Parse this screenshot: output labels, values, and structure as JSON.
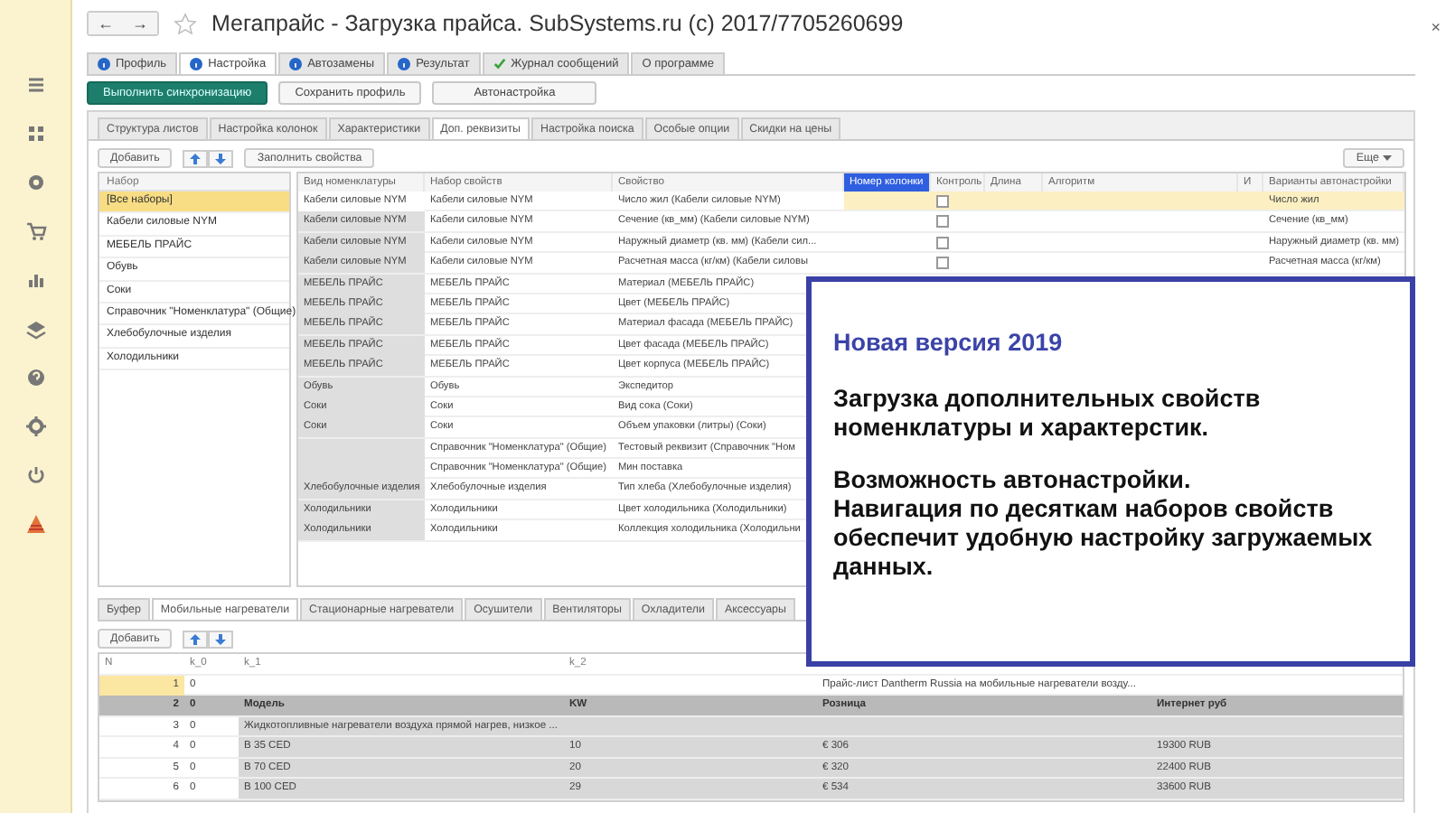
{
  "window": {
    "title": "Мегапрайс - Загрузка прайса. SubSystems.ru (c) 2017/7705260699",
    "back": "←",
    "forward": "→",
    "close": "×"
  },
  "tabs": [
    {
      "label": "Профиль",
      "kind": "info",
      "selected": false
    },
    {
      "label": "Настройка",
      "kind": "info",
      "selected": true
    },
    {
      "label": "Автозамены",
      "kind": "info",
      "selected": false
    },
    {
      "label": "Результат",
      "kind": "info",
      "selected": false
    },
    {
      "label": "Журнал сообщений",
      "kind": "check",
      "selected": false
    },
    {
      "label": "О программе",
      "kind": "plain",
      "selected": false
    }
  ],
  "actions": [
    {
      "label": "Выполнить синхронизацию",
      "kind": "primary"
    },
    {
      "label": "Сохранить профиль",
      "kind": "normal"
    },
    {
      "label": "Автонастройка",
      "kind": "wide"
    }
  ],
  "subtabs": [
    {
      "label": "Структура листов",
      "selected": false
    },
    {
      "label": "Настройка колонок",
      "selected": false
    },
    {
      "label": "Характеристики",
      "selected": false
    },
    {
      "label": "Доп. реквизиты",
      "selected": true
    },
    {
      "label": "Настройка поиска",
      "selected": false
    },
    {
      "label": "Особые опции",
      "selected": false
    },
    {
      "label": "Скидки на цены",
      "selected": false
    }
  ],
  "toolbar": {
    "add": "Добавить",
    "fill": "Заполнить свойства",
    "more": "Еще"
  },
  "sets": {
    "header": "Набор",
    "items": [
      {
        "label": "[Все наборы]",
        "selected": true
      },
      {
        "label": "Кабели силовые NYM",
        "selected": false
      },
      {
        "label": "МЕБЕЛЬ ПРАЙС",
        "selected": false
      },
      {
        "label": "Обувь",
        "selected": false
      },
      {
        "label": "Соки",
        "selected": false
      },
      {
        "label": "Справочник \"Номенклатура\" (Общие)",
        "selected": false
      },
      {
        "label": "Хлебобулочные изделия",
        "selected": false
      },
      {
        "label": "Холодильники",
        "selected": false
      }
    ]
  },
  "properties": {
    "columns": [
      {
        "label": "Вид номенклатуры",
        "selected": false
      },
      {
        "label": "Набор свойств",
        "selected": false
      },
      {
        "label": "Свойство",
        "selected": false
      },
      {
        "label": "Номер колонки",
        "selected": true
      },
      {
        "label": "Контроль",
        "selected": false
      },
      {
        "label": "Длина",
        "selected": false
      },
      {
        "label": "Алгоритм",
        "selected": false
      },
      {
        "label": "И",
        "selected": false
      },
      {
        "label": "Варианты автонастройки",
        "selected": false
      }
    ],
    "rows": [
      {
        "type": "Кабели силовые NYM",
        "set": "Кабели силовые NYM",
        "property": "Число жил (Кабели силовые NYM)",
        "checked": false,
        "variant": "Число жил",
        "selected": true
      },
      {
        "type": "Кабели силовые NYM",
        "set": "Кабели силовые NYM",
        "property": "Сечение (кв_мм) (Кабели силовые NYM)",
        "checked": false,
        "variant": "Сечение (кв_мм)",
        "selected": false
      },
      {
        "type": "Кабели силовые NYM",
        "set": "Кабели силовые NYM",
        "property": "Наружный диаметр (кв. мм) (Кабели сил...",
        "checked": false,
        "variant": "Наружный диаметр (кв. мм)",
        "selected": false
      },
      {
        "type": "Кабели силовые NYM",
        "set": "Кабели силовые NYM",
        "property": "Расчетная масса (кг/км) (Кабели силовы",
        "checked": false,
        "variant": "Расчетная масса (кг/км)",
        "selected": false
      },
      {
        "type": "МЕБЕЛЬ ПРАЙС",
        "set": "МЕБЕЛЬ ПРАЙС",
        "property": "Материал (МЕБЕЛЬ ПРАЙС)",
        "selected": false
      },
      {
        "type": "МЕБЕЛЬ ПРАЙС",
        "set": "МЕБЕЛЬ ПРАЙС",
        "property": "Цвет (МЕБЕЛЬ ПРАЙС)",
        "selected": false
      },
      {
        "type": "МЕБЕЛЬ ПРАЙС",
        "set": "МЕБЕЛЬ ПРАЙС",
        "property": "Материал фасада (МЕБЕЛЬ ПРАЙС)",
        "selected": false
      },
      {
        "type": "МЕБЕЛЬ ПРАЙС",
        "set": "МЕБЕЛЬ ПРАЙС",
        "property": "Цвет фасада (МЕБЕЛЬ ПРАЙС)",
        "selected": false
      },
      {
        "type": "МЕБЕЛЬ ПРАЙС",
        "set": "МЕБЕЛЬ ПРАЙС",
        "property": "Цвет корпуса (МЕБЕЛЬ ПРАЙС)",
        "selected": false
      },
      {
        "type": "Обувь",
        "set": "Обувь",
        "property": "Экспедитор",
        "selected": false
      },
      {
        "type": "Соки",
        "set": "Соки",
        "property": "Вид сока (Соки)",
        "selected": false
      },
      {
        "type": "Соки",
        "set": "Соки",
        "property": "Объем упаковки (литры) (Соки)",
        "selected": false
      },
      {
        "set": "Справочник \"Номенклатура\" (Общие)",
        "property": "Тестовый реквизит (Справочник \"Ном",
        "selected": false
      },
      {
        "set": "Справочник \"Номенклатура\" (Общие)",
        "property": "Мин поставка",
        "selected": false
      },
      {
        "type": "Хлебобулочные изделия",
        "set": "Хлебобулочные изделия",
        "property": "Тип хлеба (Хлебобулочные изделия)",
        "selected": false
      },
      {
        "type": "Холодильники",
        "set": "Холодильники",
        "property": "Цвет холодильника (Холодильники)",
        "selected": false
      },
      {
        "type": "Холодильники",
        "set": "Холодильники",
        "property": "Коллекция холодильника (Холодильни",
        "selected": false
      }
    ]
  },
  "lower_tabs": [
    {
      "label": "Буфер",
      "selected": false
    },
    {
      "label": "Мобильные нагреватели",
      "selected": true
    },
    {
      "label": "Стационарные нагреватели",
      "selected": false
    },
    {
      "label": "Осушители",
      "selected": false
    },
    {
      "label": "Вентиляторы",
      "selected": false
    },
    {
      "label": "Охладители",
      "selected": false
    },
    {
      "label": "Аксессуары",
      "selected": false
    }
  ],
  "lower_toolbar": {
    "add": "Добавить"
  },
  "sheet": {
    "columns": [
      "N",
      "k_0",
      "k_1",
      "k_2"
    ],
    "rows": [
      {
        "kind": "title",
        "selected": true,
        "n": "1",
        "k_0": "0",
        "k_3": "Прайс-лист Dantherm Russia на мобильные нагреватели возду..."
      },
      {
        "kind": "header",
        "selected": false,
        "n": "2",
        "k_0": "0",
        "k_1": "Модель",
        "k_2": "KW",
        "k_3": "Розница",
        "k_4": "Интернет руб"
      },
      {
        "kind": "item",
        "selected": false,
        "n": "3",
        "k_0": "0",
        "k_1": "Жидкотопливные нагреватели воздуха прямой нагрев, низкое ..."
      },
      {
        "kind": "item",
        "selected": false,
        "n": "4",
        "k_0": "0",
        "k_1": "B 35 CED",
        "k_2": "10",
        "k_3": "€ 306",
        "k_4": "19300 RUB"
      },
      {
        "kind": "item",
        "selected": false,
        "n": "5",
        "k_0": "0",
        "k_1": "B 70 CED",
        "k_2": "20",
        "k_3": "€ 320",
        "k_4": "22400 RUB"
      },
      {
        "kind": "item",
        "selected": false,
        "n": "6",
        "k_0": "0",
        "k_1": "B 100 CED",
        "k_2": "29",
        "k_3": "€ 534",
        "k_4": "33600 RUB"
      }
    ]
  },
  "promo": {
    "title": "Новая версия 2019",
    "blocks": [
      [
        "Загрузка дополнительных свойств номенклатуры и характерстик."
      ],
      [
        "Возможность автонастройки.",
        "Навигация по десяткам наборов свойств обеспечит удобную настройку загружаемых данных."
      ]
    ]
  }
}
